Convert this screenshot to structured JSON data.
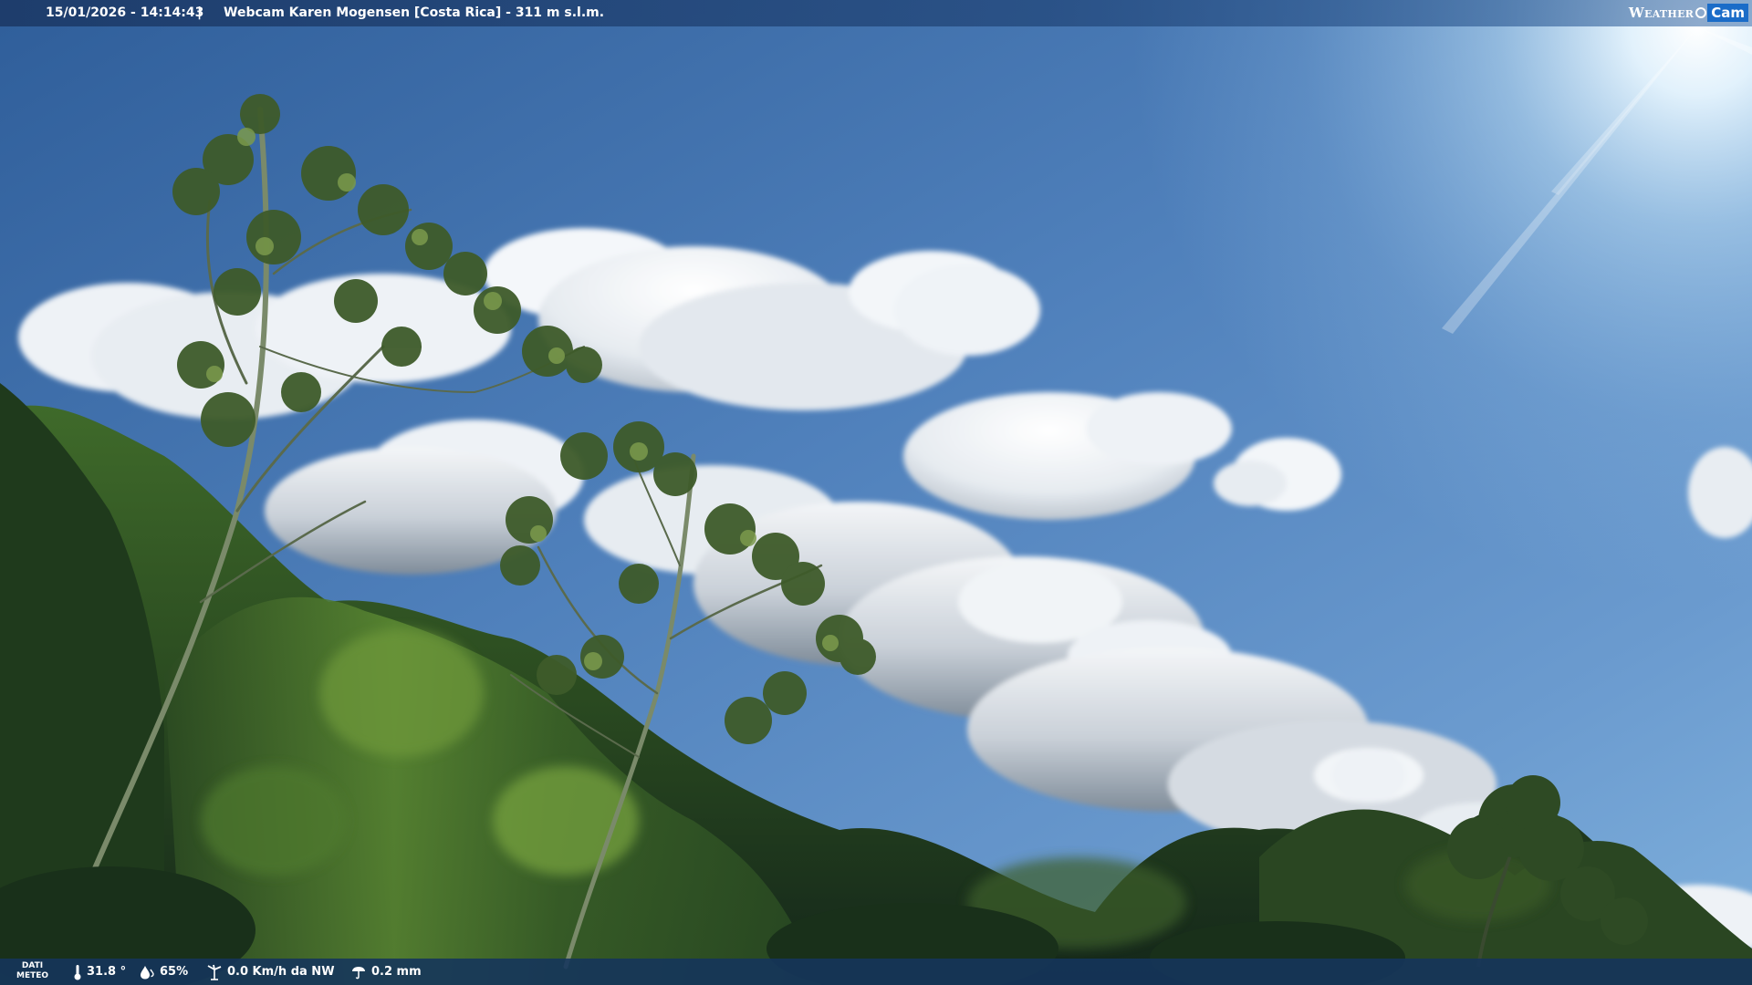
{
  "header": {
    "datetime": "15/01/2026 - 14:14:43",
    "separator": "|",
    "title": "Webcam Karen Mogensen [Costa Rica]  - 311 m s.l.m.",
    "logo": {
      "weather": "Weather",
      "cam": "Cam"
    }
  },
  "footer": {
    "label_line1": "DATI",
    "label_line2": "METEO",
    "temperature": "31.8 °",
    "humidity": "65%",
    "wind": "0.0 Km/h da NW",
    "rain": "0.2 mm"
  },
  "icons": {
    "temperature": "thermometer-icon",
    "humidity": "humidity-drop-icon",
    "wind": "wind-icon",
    "rain": "rain-icon"
  },
  "colors": {
    "sky_top": "#3a6aa8",
    "sky_mid": "#5f8fc4",
    "sun_glow": "#e8f6ff",
    "foliage_dark": "#1f3a1c",
    "foliage_light": "#5f8a34",
    "bar": "#14345c",
    "logo_accent": "#1a6cc8"
  }
}
